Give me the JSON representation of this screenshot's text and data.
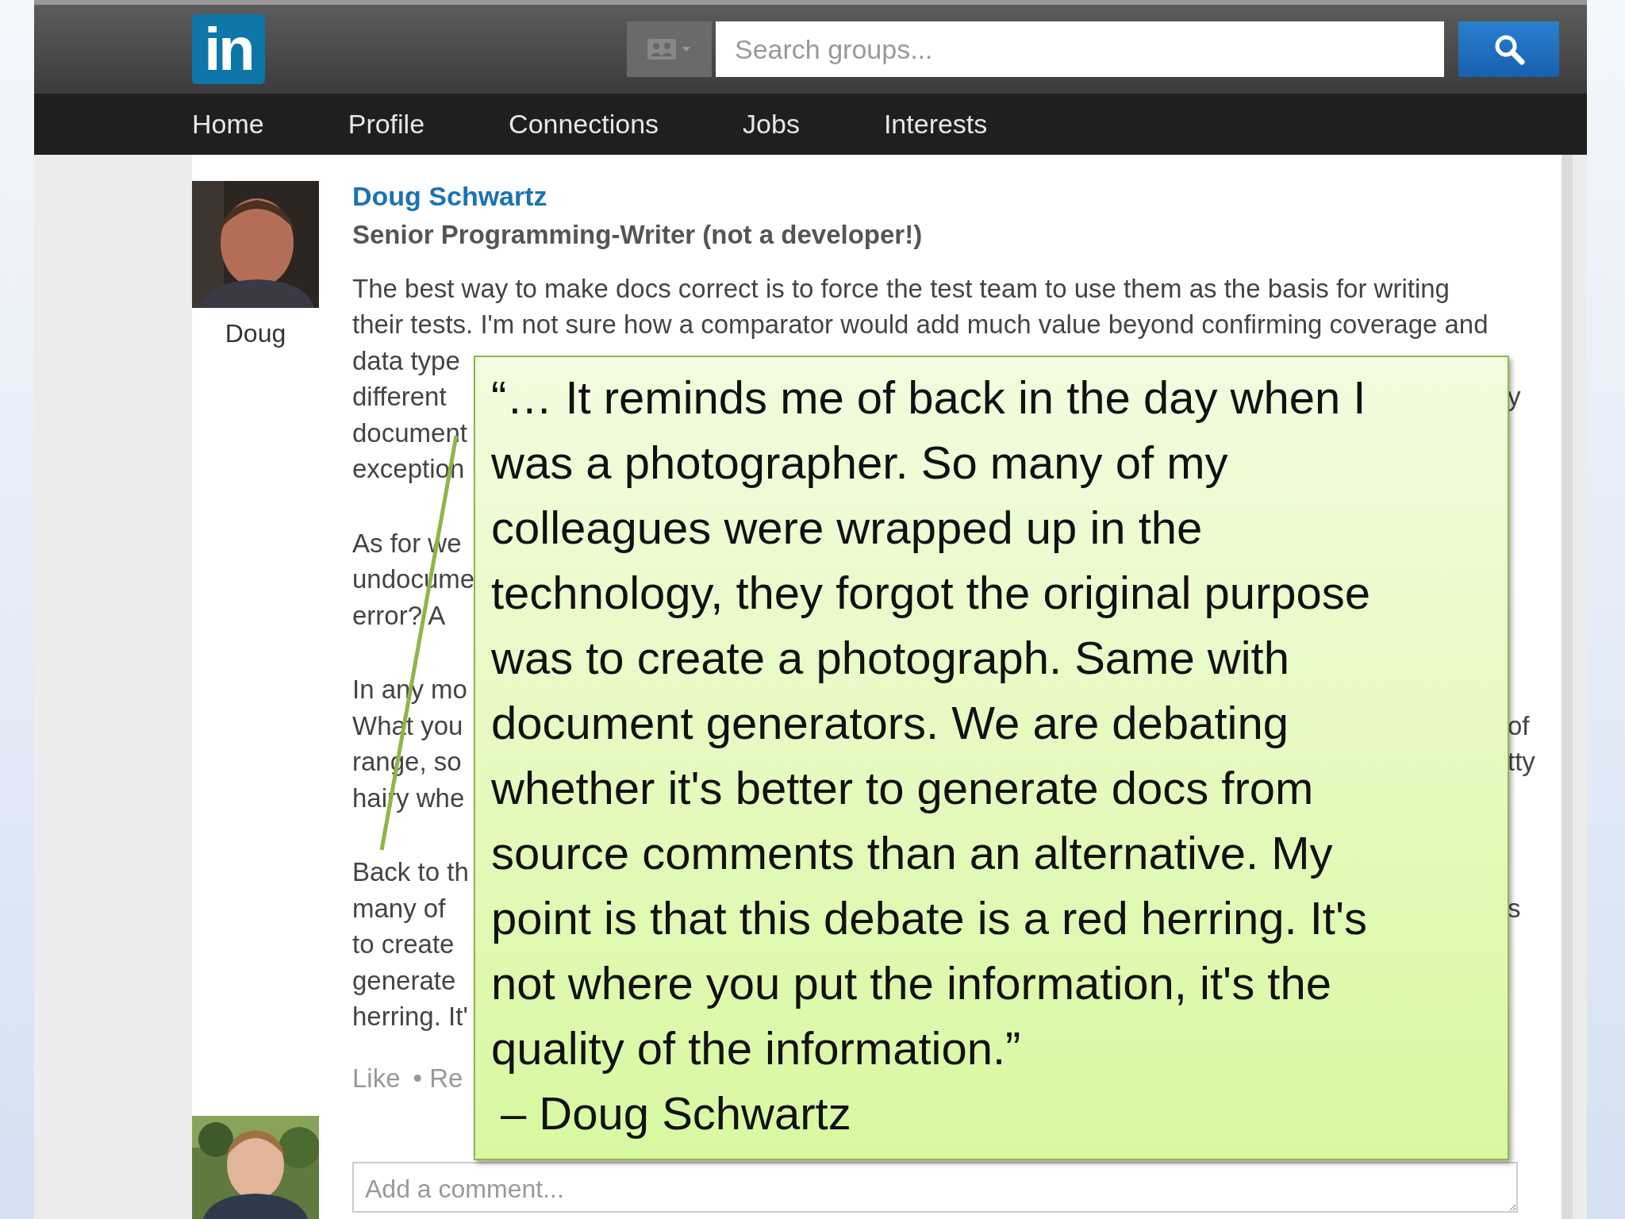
{
  "header": {
    "logo": "in",
    "search": {
      "placeholder": "Search groups..."
    }
  },
  "nav": [
    {
      "label": "Home"
    },
    {
      "label": "Profile"
    },
    {
      "label": "Connections"
    },
    {
      "label": "Jobs"
    },
    {
      "label": "Interests"
    }
  ],
  "post": {
    "author": "Doug Schwartz",
    "headline": "Senior Programming-Writer (not a developer!)",
    "avatar": {
      "kind": "picture"
    },
    "avatar_caption": "Doug",
    "paragraphs": [
      {
        "lines": [
          {
            "left": "The best way to make docs correct is to force the test team to use them as the basis for writing"
          },
          {
            "left": "their tests. I'm not sure how a comparator would add much value beyond confirming coverage and"
          },
          {
            "left": "data type"
          },
          {
            "left": "different",
            "right": "y"
          },
          {
            "left": "document"
          },
          {
            "left": "exception"
          }
        ]
      },
      {
        "lines": [
          {
            "left": "As for we"
          },
          {
            "left": "undocume"
          },
          {
            "left": "error? A"
          }
        ]
      },
      {
        "lines": [
          {
            "left": "In any mo"
          },
          {
            "left": "What you",
            "right": "of"
          },
          {
            "left": "range, so",
            "right": "tty"
          },
          {
            "left": "hairy whe"
          }
        ]
      },
      {
        "lines": [
          {
            "left": "Back to th"
          },
          {
            "left": "many of",
            "right": "s"
          },
          {
            "left": "to create"
          },
          {
            "left": "generate"
          },
          {
            "left": "herring. It'"
          }
        ]
      }
    ],
    "actions": [
      "Like",
      "• Re"
    ]
  },
  "comment": {
    "avatar": {
      "kind": "picture"
    },
    "placeholder": "Add a comment..."
  },
  "callout": {
    "lines": [
      "“… It reminds me of back in the day when I",
      "was a photographer. So many of my",
      "colleagues were wrapped up in the",
      "technology, they forgot the original purpose",
      "was to create a photograph. Same with",
      "document generators. We are debating",
      "whether it's better to generate docs from",
      "source comments than an alternative. My",
      "point is that this debate is a red herring. It's",
      "not where you put the information, it's the",
      "quality of the information.”"
    ],
    "attribution": "– Doug Schwartz"
  }
}
